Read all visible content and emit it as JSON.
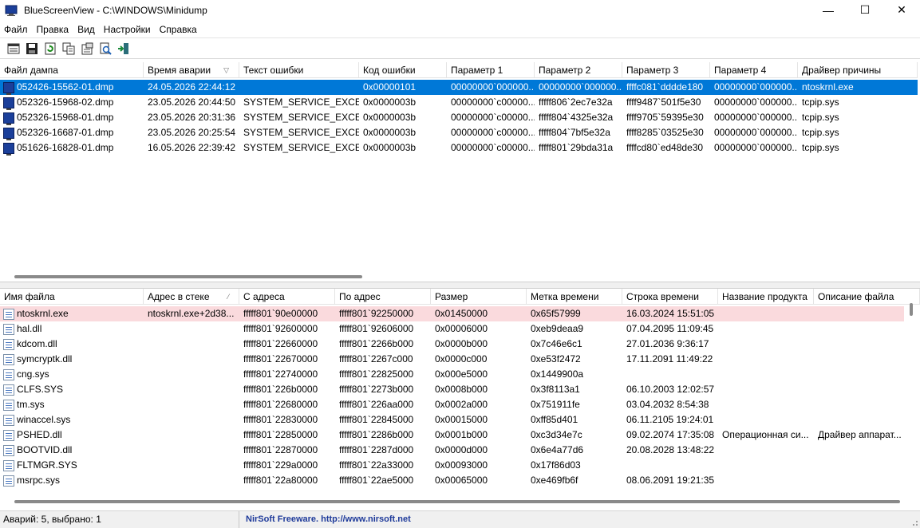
{
  "window": {
    "title": "BlueScreenView  -  C:\\WINDOWS\\Minidump",
    "minimize": "—",
    "maximize": "☐",
    "close": "✕"
  },
  "menu": [
    "Файл",
    "Правка",
    "Вид",
    "Настройки",
    "Справка"
  ],
  "toolbar": [
    "properties-icon",
    "save-icon",
    "refresh-icon",
    "copy-icon",
    "html-report-icon",
    "find-icon",
    "exit-icon"
  ],
  "crashes": {
    "columns": [
      "Файл дампа",
      "Время аварии",
      "Текст ошибки",
      "Код ошибки",
      "Параметр 1",
      "Параметр 2",
      "Параметр 3",
      "Параметр 4",
      "Драйвер причины"
    ],
    "sort_column": 1,
    "sort_indicator": "▽",
    "rows": [
      [
        "052426-15562-01.dmp",
        "24.05.2026 22:44:12",
        "",
        "0x00000101",
        "00000000`000000...",
        "00000000`000000...",
        "ffffc081`dddde180",
        "00000000`000000...",
        "ntoskrnl.exe"
      ],
      [
        "052326-15968-02.dmp",
        "23.05.2026 20:44:50",
        "SYSTEM_SERVICE_EXCE...",
        "0x0000003b",
        "00000000`c00000...",
        "fffff806`2ec7e32a",
        "ffff9487`501f5e30",
        "00000000`000000...",
        "tcpip.sys"
      ],
      [
        "052326-15968-01.dmp",
        "23.05.2026 20:31:36",
        "SYSTEM_SERVICE_EXCE...",
        "0x0000003b",
        "00000000`c00000...",
        "fffff804`4325e32a",
        "ffff9705`59395e30",
        "00000000`000000...",
        "tcpip.sys"
      ],
      [
        "052326-16687-01.dmp",
        "23.05.2026 20:25:54",
        "SYSTEM_SERVICE_EXCE...",
        "0x0000003b",
        "00000000`c00000...",
        "fffff804`7bf5e32a",
        "ffff8285`03525e30",
        "00000000`000000...",
        "tcpip.sys"
      ],
      [
        "051626-16828-01.dmp",
        "16.05.2026 22:39:42",
        "SYSTEM_SERVICE_EXCE...",
        "0x0000003b",
        "00000000`c00000...",
        "fffff801`29bda31a",
        "ffffcd80`ed48de30",
        "00000000`000000...",
        "tcpip.sys"
      ]
    ],
    "selected_row": 0
  },
  "drivers": {
    "columns": [
      "Имя файла",
      "Адрес в стеке",
      "С адреса",
      "По адрес",
      "Размер",
      "Метка времени",
      "Строка времени",
      "Название продукта",
      "Описание файла"
    ],
    "sort_column": 1,
    "sort_indicator": "⁄",
    "rows": [
      [
        "ntoskrnl.exe",
        "ntoskrnl.exe+2d38...",
        "fffff801`90e00000",
        "fffff801`92250000",
        "0x01450000",
        "0x65f57999",
        "16.03.2024 15:51:05",
        "",
        ""
      ],
      [
        "hal.dll",
        "",
        "fffff801`92600000",
        "fffff801`92606000",
        "0x00006000",
        "0xeb9deaa9",
        "07.04.2095 11:09:45",
        "",
        ""
      ],
      [
        "kdcom.dll",
        "",
        "fffff801`22660000",
        "fffff801`2266b000",
        "0x0000b000",
        "0x7c46e6c1",
        "27.01.2036 9:36:17",
        "",
        ""
      ],
      [
        "symcryptk.dll",
        "",
        "fffff801`22670000",
        "fffff801`2267c000",
        "0x0000c000",
        "0xe53f2472",
        "17.11.2091 11:49:22",
        "",
        ""
      ],
      [
        "cng.sys",
        "",
        "fffff801`22740000",
        "fffff801`22825000",
        "0x000e5000",
        "0x1449900a",
        "",
        "",
        ""
      ],
      [
        "CLFS.SYS",
        "",
        "fffff801`226b0000",
        "fffff801`2273b000",
        "0x0008b000",
        "0x3f8113a1",
        "06.10.2003 12:02:57",
        "",
        ""
      ],
      [
        "tm.sys",
        "",
        "fffff801`22680000",
        "fffff801`226aa000",
        "0x0002a000",
        "0x751911fe",
        "03.04.2032 8:54:38",
        "",
        ""
      ],
      [
        "winaccel.sys",
        "",
        "fffff801`22830000",
        "fffff801`22845000",
        "0x00015000",
        "0xff85d401",
        "06.11.2105 19:24:01",
        "",
        ""
      ],
      [
        "PSHED.dll",
        "",
        "fffff801`22850000",
        "fffff801`2286b000",
        "0x0001b000",
        "0xc3d34e7c",
        "09.02.2074 17:35:08",
        "Операционная си...",
        "Драйвер аппарат..."
      ],
      [
        "BOOTVID.dll",
        "",
        "fffff801`22870000",
        "fffff801`2287d000",
        "0x0000d000",
        "0x6e4a77d6",
        "20.08.2028 13:48:22",
        "",
        ""
      ],
      [
        "FLTMGR.SYS",
        "",
        "fffff801`229a0000",
        "fffff801`22a33000",
        "0x00093000",
        "0x17f86d03",
        "",
        "",
        ""
      ],
      [
        "msrpc.sys",
        "",
        "fffff801`22a80000",
        "fffff801`22ae5000",
        "0x00065000",
        "0xe469fb6f",
        "08.06.2091 19:21:35",
        "",
        ""
      ]
    ],
    "highlight_row": 0
  },
  "status": {
    "count": "Аварий: 5, выбрано: 1",
    "link": "NirSoft Freeware.  http://www.nirsoft.net"
  },
  "colors": {
    "selection": "#0078d7",
    "highlight": "#fadadd",
    "link": "#1e3a9a"
  }
}
